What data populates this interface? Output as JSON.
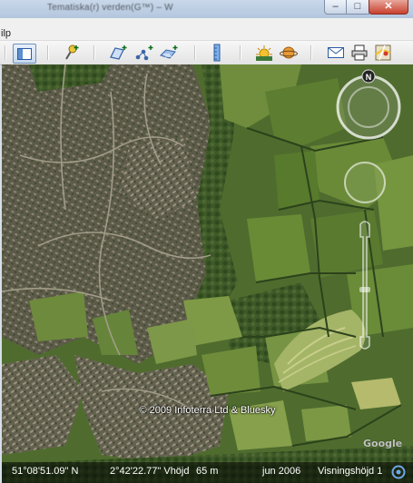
{
  "window": {
    "title": "Tematiska(r) verden(G™) – W",
    "min_glyph": "–",
    "max_glyph": "□",
    "close_glyph": "✕"
  },
  "menu": {
    "help_label": "ilp"
  },
  "toolbar": {
    "items": [
      {
        "icon": "sidebar-toggle-icon"
      },
      {
        "icon": "add-placemark-icon"
      },
      {
        "icon": "add-polygon-icon"
      },
      {
        "icon": "add-path-icon"
      },
      {
        "icon": "add-image-overlay-icon"
      },
      {
        "icon": "ruler-icon"
      },
      {
        "icon": "sunlight-icon"
      },
      {
        "icon": "planet-icon"
      },
      {
        "icon": "email-icon"
      },
      {
        "icon": "print-icon"
      },
      {
        "icon": "view-in-maps-icon"
      }
    ]
  },
  "map": {
    "copyright": "© 2009 Infoterra Ltd & Bluesky",
    "logo": "Google",
    "compass_north": "N"
  },
  "status": {
    "latitude": "51°08'51.09\" N",
    "longitude": "2°42'22.77\" V",
    "altitude_label": "höjd",
    "altitude": "65 m",
    "imagery_date": "jun 2006",
    "eye_altitude_label": "Visningshöjd",
    "eye_altitude": "1"
  }
}
